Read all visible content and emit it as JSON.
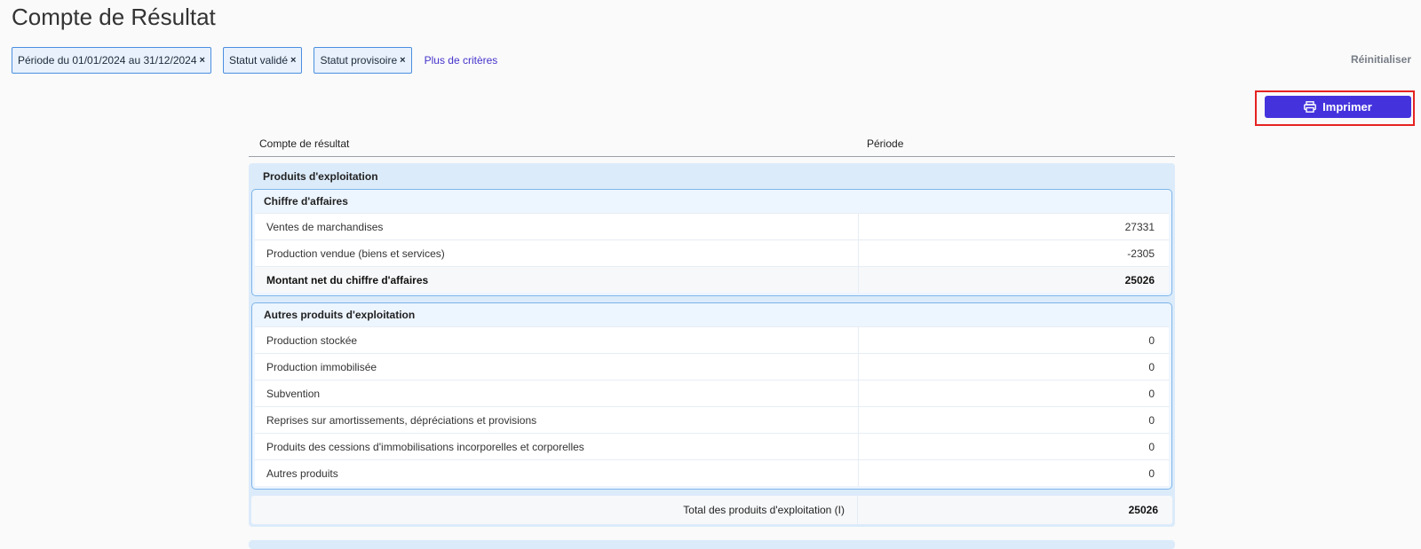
{
  "page": {
    "title": "Compte de Résultat"
  },
  "filters": {
    "chips": [
      {
        "label": "Période du 01/01/2024 au 31/12/2024",
        "remove": "×"
      },
      {
        "label": "Statut validé",
        "remove": "×"
      },
      {
        "label": "Statut provisoire",
        "remove": "×"
      }
    ],
    "more_label": "Plus de critères",
    "reset_label": "Réinitialiser"
  },
  "toolbar": {
    "print_label": "Imprimer",
    "print_icon": "printer-icon",
    "accent_color": "#4433dd",
    "highlight_color": "#e52222"
  },
  "report": {
    "columns": [
      "Compte de résultat",
      "Période"
    ],
    "section": {
      "title": "Produits d'exploitation",
      "groups": [
        {
          "title": "Chiffre d'affaires",
          "rows": [
            {
              "label": "Ventes de marchandises",
              "value": "27331"
            },
            {
              "label": "Production vendue (biens et services)",
              "value": "-2305"
            },
            {
              "label": "Montant net du chiffre d'affaires",
              "value": "25026",
              "total": true
            }
          ]
        },
        {
          "title": "Autres produits d'exploitation",
          "rows": [
            {
              "label": "Production stockée",
              "value": "0"
            },
            {
              "label": "Production immobilisée",
              "value": "0"
            },
            {
              "label": "Subvention",
              "value": "0"
            },
            {
              "label": "Reprises sur amortissements, dépréciations et provisions",
              "value": "0"
            },
            {
              "label": "Produits des cessions d'immobilisations incorporelles et corporelles",
              "value": "0"
            },
            {
              "label": "Autres produits",
              "value": "0"
            }
          ]
        }
      ],
      "total": {
        "label": "Total des produits d'exploitation (I)",
        "value": "25026"
      }
    }
  }
}
